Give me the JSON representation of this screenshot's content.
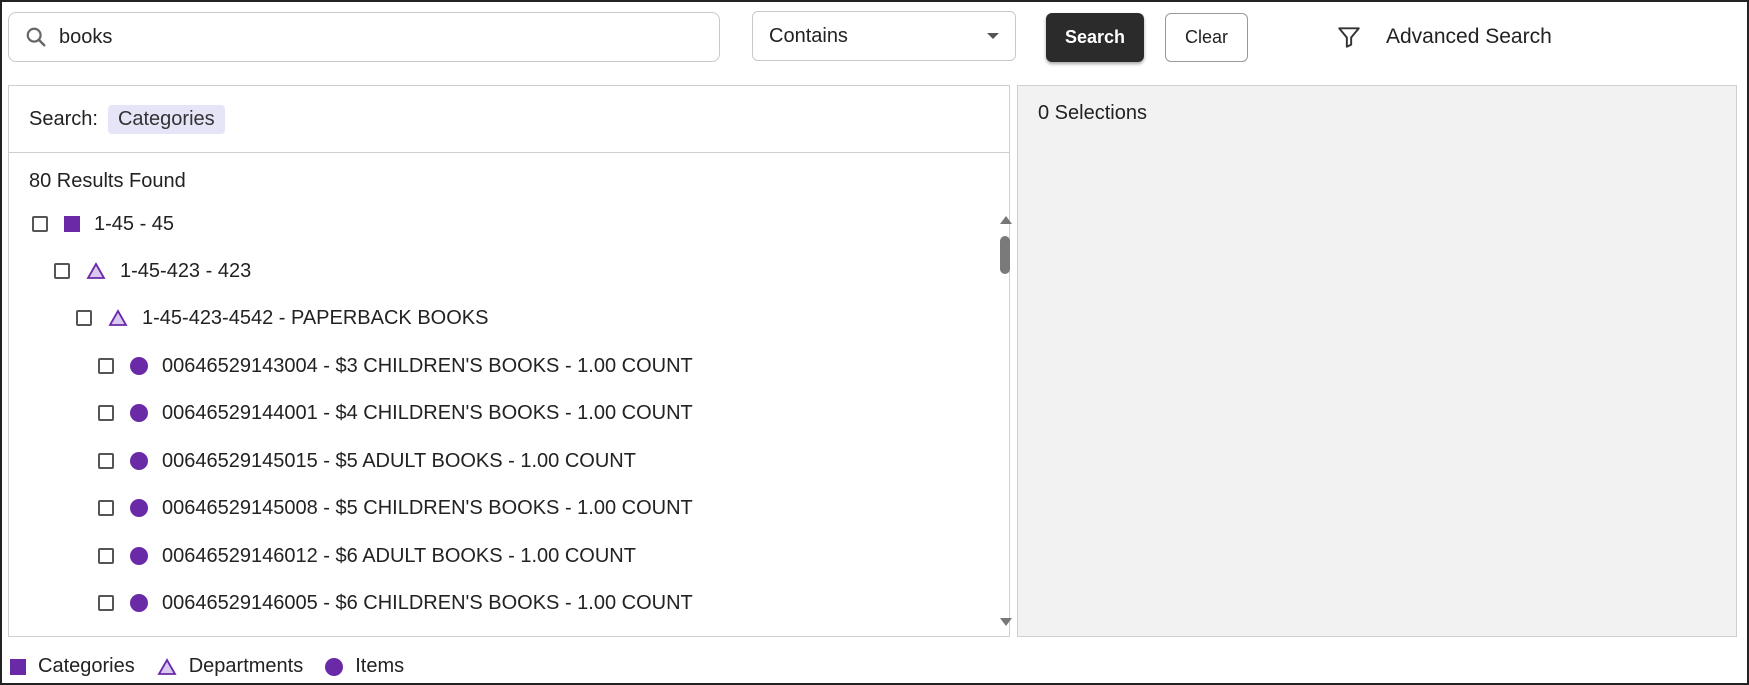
{
  "search": {
    "value": "books"
  },
  "mode_select": {
    "selected": "Contains"
  },
  "buttons": {
    "search": "Search",
    "clear": "Clear"
  },
  "advanced_search": "Advanced Search",
  "left_panel": {
    "search_label": "Search:",
    "search_chip": "Categories",
    "results_count": "80 Results Found",
    "rows": [
      {
        "type": "category",
        "label": "1-45 - 45"
      },
      {
        "type": "department",
        "label": "1-45-423 - 423"
      },
      {
        "type": "department",
        "label": "1-45-423-4542 - PAPERBACK BOOKS"
      },
      {
        "type": "item",
        "label": "00646529143004 - $3 CHILDREN'S BOOKS - 1.00 COUNT"
      },
      {
        "type": "item",
        "label": "00646529144001 - $4 CHILDREN'S BOOKS - 1.00 COUNT"
      },
      {
        "type": "item",
        "label": "00646529145015 - $5 ADULT BOOKS - 1.00 COUNT"
      },
      {
        "type": "item",
        "label": "00646529145008 - $5 CHILDREN'S BOOKS - 1.00 COUNT"
      },
      {
        "type": "item",
        "label": "00646529146012 - $6 ADULT BOOKS - 1.00 COUNT"
      },
      {
        "type": "item",
        "label": "00646529146005 - $6 CHILDREN'S BOOKS - 1.00 COUNT"
      }
    ]
  },
  "right_panel": {
    "selections": "0 Selections"
  },
  "legend": {
    "categories": "Categories",
    "departments": "Departments",
    "items": "Items"
  },
  "colors": {
    "accent": "#6a2aa8",
    "chip_bg": "#e6e4f7",
    "primary_button": "#2b2b2b",
    "right_panel_bg": "#f2f2f2"
  }
}
